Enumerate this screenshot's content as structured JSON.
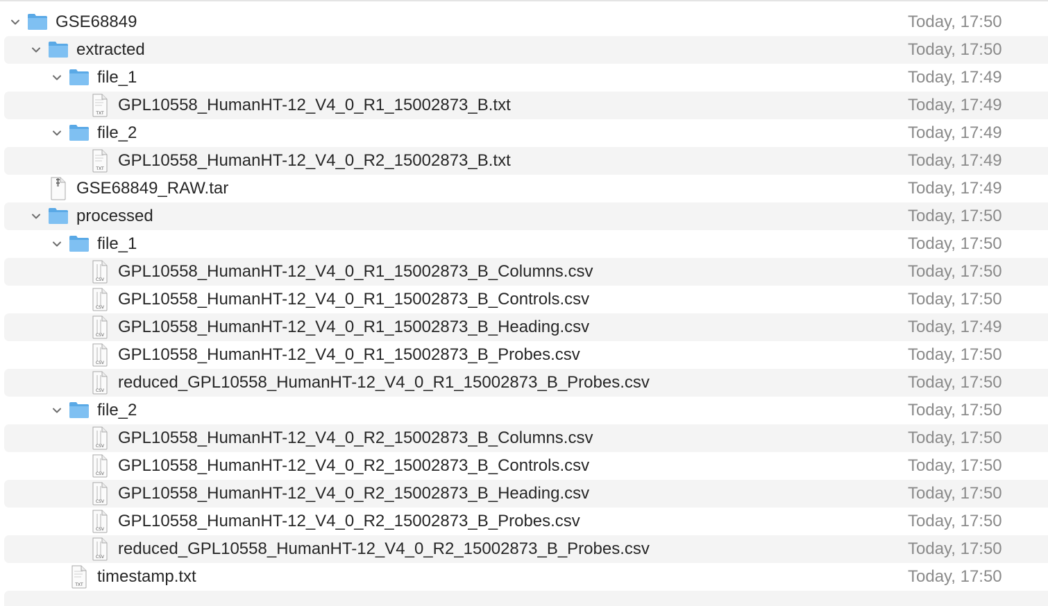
{
  "colors": {
    "folder_accent": "#5aa9e6",
    "folder_light": "#7fc0f2",
    "row_stripe": "#f4f4f4",
    "text": "#262626",
    "date_text": "#8a8a8a"
  },
  "rows": [
    {
      "name": "GSE68849",
      "date": "Today, 17:50",
      "kind": "folder",
      "icon": "folder-icon",
      "expanded": true
    },
    {
      "name": "extracted",
      "date": "Today, 17:50",
      "kind": "folder",
      "icon": "folder-icon",
      "expanded": true
    },
    {
      "name": "file_1",
      "date": "Today, 17:49",
      "kind": "folder",
      "icon": "folder-icon",
      "expanded": true
    },
    {
      "name": "GPL10558_HumanHT-12_V4_0_R1_15002873_B.txt",
      "date": "Today, 17:49",
      "kind": "file",
      "icon": "txt-file-icon",
      "badge": "TXT"
    },
    {
      "name": "file_2",
      "date": "Today, 17:49",
      "kind": "folder",
      "icon": "folder-icon",
      "expanded": true
    },
    {
      "name": "GPL10558_HumanHT-12_V4_0_R2_15002873_B.txt",
      "date": "Today, 17:49",
      "kind": "file",
      "icon": "txt-file-icon",
      "badge": "TXT"
    },
    {
      "name": "GSE68849_RAW.tar",
      "date": "Today, 17:49",
      "kind": "file",
      "icon": "archive-file-icon",
      "badge": ""
    },
    {
      "name": "processed",
      "date": "Today, 17:50",
      "kind": "folder",
      "icon": "folder-icon",
      "expanded": true
    },
    {
      "name": "file_1",
      "date": "Today, 17:50",
      "kind": "folder",
      "icon": "folder-icon",
      "expanded": true
    },
    {
      "name": "GPL10558_HumanHT-12_V4_0_R1_15002873_B_Columns.csv",
      "date": "Today, 17:50",
      "kind": "file",
      "icon": "csv-file-icon",
      "badge": "CSV"
    },
    {
      "name": "GPL10558_HumanHT-12_V4_0_R1_15002873_B_Controls.csv",
      "date": "Today, 17:50",
      "kind": "file",
      "icon": "csv-file-icon",
      "badge": "CSV"
    },
    {
      "name": "GPL10558_HumanHT-12_V4_0_R1_15002873_B_Heading.csv",
      "date": "Today, 17:49",
      "kind": "file",
      "icon": "csv-file-icon",
      "badge": "CSV"
    },
    {
      "name": "GPL10558_HumanHT-12_V4_0_R1_15002873_B_Probes.csv",
      "date": "Today, 17:50",
      "kind": "file",
      "icon": "csv-file-icon",
      "badge": "CSV"
    },
    {
      "name": "reduced_GPL10558_HumanHT-12_V4_0_R1_15002873_B_Probes.csv",
      "date": "Today, 17:50",
      "kind": "file",
      "icon": "csv-file-icon",
      "badge": "CSV"
    },
    {
      "name": "file_2",
      "date": "Today, 17:50",
      "kind": "folder",
      "icon": "folder-icon",
      "expanded": true
    },
    {
      "name": "GPL10558_HumanHT-12_V4_0_R2_15002873_B_Columns.csv",
      "date": "Today, 17:50",
      "kind": "file",
      "icon": "csv-file-icon",
      "badge": "CSV"
    },
    {
      "name": "GPL10558_HumanHT-12_V4_0_R2_15002873_B_Controls.csv",
      "date": "Today, 17:50",
      "kind": "file",
      "icon": "csv-file-icon",
      "badge": "CSV"
    },
    {
      "name": "GPL10558_HumanHT-12_V4_0_R2_15002873_B_Heading.csv",
      "date": "Today, 17:50",
      "kind": "file",
      "icon": "csv-file-icon",
      "badge": "CSV"
    },
    {
      "name": "GPL10558_HumanHT-12_V4_0_R2_15002873_B_Probes.csv",
      "date": "Today, 17:50",
      "kind": "file",
      "icon": "csv-file-icon",
      "badge": "CSV"
    },
    {
      "name": "reduced_GPL10558_HumanHT-12_V4_0_R2_15002873_B_Probes.csv",
      "date": "Today, 17:50",
      "kind": "file",
      "icon": "csv-file-icon",
      "badge": "CSV"
    },
    {
      "name": "timestamp.txt",
      "date": "Today, 17:50",
      "kind": "file",
      "icon": "txt-file-icon",
      "badge": "TXT"
    }
  ]
}
